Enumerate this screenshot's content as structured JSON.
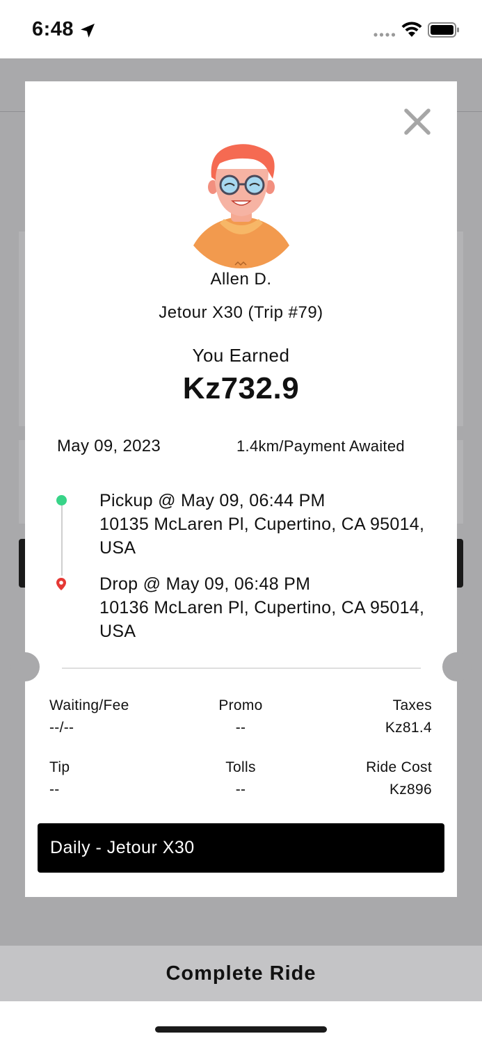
{
  "status_bar": {
    "time": "6:48",
    "icons": [
      "location-arrow-icon",
      "signal-icon",
      "wifi-icon",
      "battery-icon"
    ]
  },
  "modal": {
    "driver_name": "Allen D.",
    "vehicle_trip": "Jetour X30 (Trip #79)",
    "earned_label": "You Earned",
    "earned_amount": "Kz732.9",
    "date": "May 09, 2023",
    "distance_status": "1.4km/Payment Awaited",
    "pickup": {
      "title": "Pickup @ May 09, 06:44 PM",
      "address": "10135 McLaren Pl, Cupertino, CA 95014, USA"
    },
    "drop": {
      "title": "Drop @ May 09, 06:48 PM",
      "address": "10136 McLaren Pl, Cupertino, CA 95014, USA"
    },
    "fares": {
      "waiting_fee_label": "Waiting/Fee",
      "waiting_fee_value": "--/--",
      "promo_label": "Promo",
      "promo_value": "--",
      "taxes_label": "Taxes",
      "taxes_value": "Kz81.4",
      "tip_label": "Tip",
      "tip_value": "--",
      "tolls_label": "Tolls",
      "tolls_value": "--",
      "ride_cost_label": "Ride Cost",
      "ride_cost_value": "Kz896"
    },
    "plan_button_label": "Daily - Jetour X30"
  },
  "footer": {
    "complete_ride_label": "Complete Ride"
  },
  "colors": {
    "pickup_dot": "#38d488",
    "drop_pin": "#e53935",
    "backdrop": "#a9a9ab",
    "button": "#000000"
  }
}
